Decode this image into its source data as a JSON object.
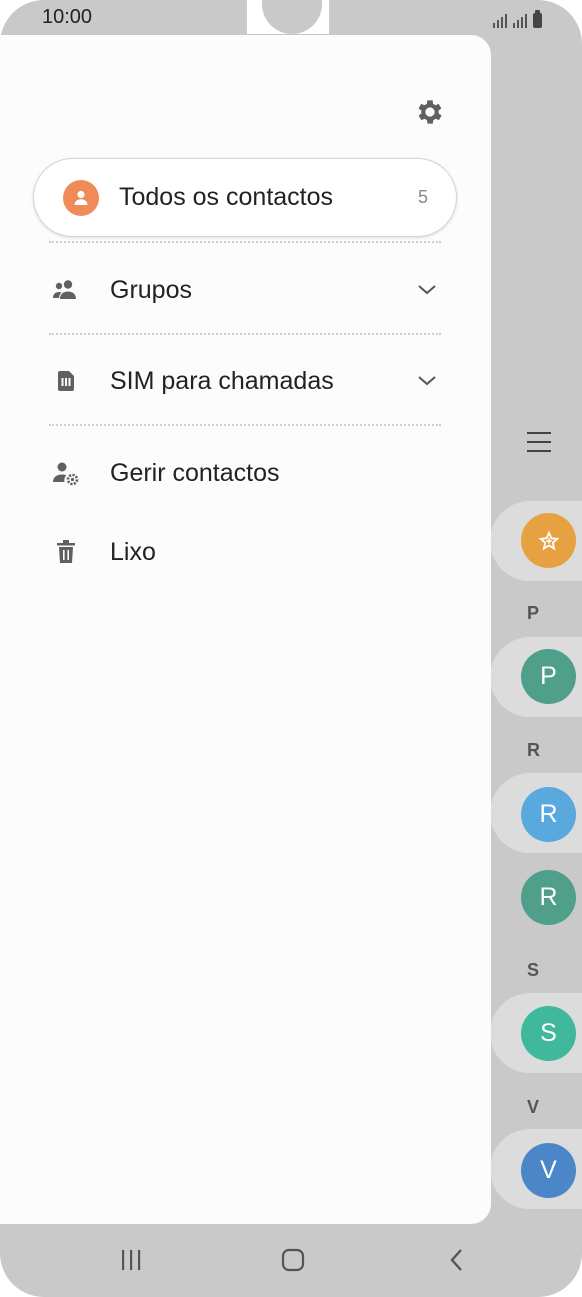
{
  "status_bar": {
    "time": "10:00"
  },
  "drawer": {
    "all_contacts": {
      "label": "Todos os contactos",
      "count": "5"
    },
    "items": [
      {
        "label": "Grupos",
        "icon": "groups-icon"
      },
      {
        "label": "SIM para chamadas",
        "icon": "sim-card-icon"
      },
      {
        "label": "Gerir contactos",
        "icon": "manage-contacts-icon"
      },
      {
        "label": "Lixo",
        "icon": "trash-icon"
      }
    ]
  },
  "background_list": {
    "sections": [
      "P",
      "R",
      "S",
      "V"
    ],
    "contacts": [
      {
        "initial": "",
        "color": "#e8a140",
        "icon": "favorite-star-icon"
      },
      {
        "initial": "P",
        "color": "#4f9f8b"
      },
      {
        "initial": "R",
        "color": "#5aa9de"
      },
      {
        "initial": "R",
        "color": "#4f9f8b"
      },
      {
        "initial": "S",
        "color": "#3fb89c"
      },
      {
        "initial": "V",
        "color": "#4a86c8"
      }
    ]
  },
  "colors": {
    "accent_avatar": "#ef8b58",
    "drawer_bg": "#fcfcfc",
    "backdrop": "#c9c9c9"
  }
}
